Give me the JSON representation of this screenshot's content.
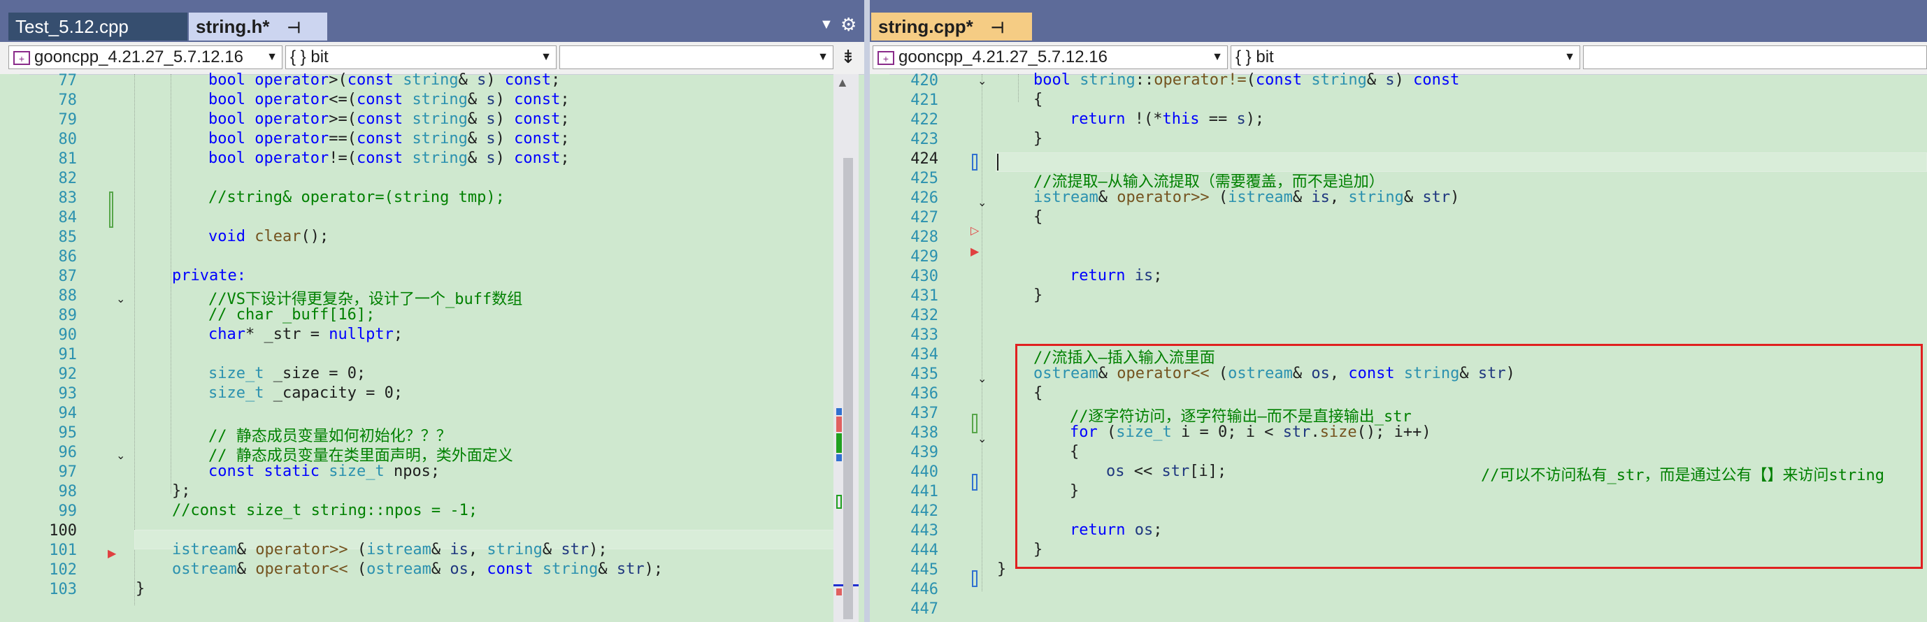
{
  "left_pane": {
    "tabs": [
      {
        "label": "Test_5.12.cpp",
        "state": "inactive"
      },
      {
        "label": "string.h*",
        "state": "active"
      }
    ],
    "nav": {
      "project": "gooncpp_4.21.27_5.7.12.16",
      "scope": "{ } bit",
      "member": ""
    },
    "current_line": "100",
    "lines": [
      {
        "n": "77"
      },
      {
        "n": "78"
      },
      {
        "n": "79"
      },
      {
        "n": "80"
      },
      {
        "n": "81"
      },
      {
        "n": "82"
      },
      {
        "n": "83"
      },
      {
        "n": "84"
      },
      {
        "n": "85"
      },
      {
        "n": "86"
      },
      {
        "n": "87"
      },
      {
        "n": "88"
      },
      {
        "n": "89"
      },
      {
        "n": "90"
      },
      {
        "n": "91"
      },
      {
        "n": "92"
      },
      {
        "n": "93"
      },
      {
        "n": "94"
      },
      {
        "n": "95"
      },
      {
        "n": "96"
      },
      {
        "n": "97"
      },
      {
        "n": "98"
      },
      {
        "n": "99"
      },
      {
        "n": "100"
      },
      {
        "n": "101"
      },
      {
        "n": "102"
      },
      {
        "n": "103"
      }
    ]
  },
  "right_pane": {
    "tabs": [
      {
        "label": "string.cpp*",
        "state": "active"
      }
    ],
    "nav": {
      "project": "gooncpp_4.21.27_5.7.12.16",
      "scope": "{ } bit",
      "member": ""
    },
    "current_line": "424",
    "lines": [
      {
        "n": "420"
      },
      {
        "n": "421"
      },
      {
        "n": "422"
      },
      {
        "n": "423"
      },
      {
        "n": "424"
      },
      {
        "n": "425"
      },
      {
        "n": "426"
      },
      {
        "n": "427"
      },
      {
        "n": "428"
      },
      {
        "n": "429"
      },
      {
        "n": "430"
      },
      {
        "n": "431"
      },
      {
        "n": "432"
      },
      {
        "n": "433"
      },
      {
        "n": "434"
      },
      {
        "n": "435"
      },
      {
        "n": "436"
      },
      {
        "n": "437"
      },
      {
        "n": "438"
      },
      {
        "n": "439"
      },
      {
        "n": "440"
      },
      {
        "n": "441"
      },
      {
        "n": "442"
      },
      {
        "n": "443"
      },
      {
        "n": "444"
      },
      {
        "n": "445"
      },
      {
        "n": "446"
      },
      {
        "n": "447"
      }
    ]
  },
  "code_text": {
    "l77": "bool operator>(const string& s) const;",
    "l78": "bool operator<=(const string& s) const;",
    "l79": "bool operator>=(const string& s) const;",
    "l80": "bool operator==(const string& s) const;",
    "l81": "bool operator!=(const string& s) const;",
    "l83": "//string& operator=(string tmp);",
    "l85": "void clear();",
    "l87": "private:",
    "l88": "//VS下设计得更复杂，设计了一个_buff数组",
    "l89": "// char _buff[16];",
    "l90": "char* _str = nullptr;",
    "l92": "size_t _size = 0;",
    "l93": "size_t _capacity = 0;",
    "l95": "// 静态成员变量如何初始化？？？",
    "l96": "// 静态成员变量在类里面声明，类外面定义",
    "l97": "const static size_t npos;",
    "l98": "};",
    "l99": "//const size_t string::npos = -1;",
    "l101": "istream& operator>> (istream& is, string& str);",
    "l102": "ostream& operator<< (ostream& os, const string& str);",
    "l103": "}",
    "r420": "bool string::operator!=(const string& s) const",
    "r421": "{",
    "r422": "return !(*this == s);",
    "r423": "}",
    "r425": "//流提取—从输入流提取（需要覆盖，而不是追加）",
    "r426": "istream& operator>> (istream& is, string& str)",
    "r427": "{",
    "r430": "return is;",
    "r431": "}",
    "r434": "//流插入—插入输入流里面",
    "r435": "ostream& operator<< (ostream& os, const string& str)",
    "r436": "{",
    "r437": "//逐字符访问，逐字符输出—而不是直接输出_str",
    "r438": "for (size_t i = 0; i < str.size(); i++)",
    "r439": "{",
    "r440": "os << str[i];",
    "r440c": "//可以不访问私有_str，而是通过公有【】来访问string",
    "r441": "}",
    "r443": "return os;",
    "r444": "}",
    "r445": "}"
  },
  "icons": {
    "pin": "pin-icon",
    "close": "close-icon",
    "dropdown": "chevron-down-icon",
    "settings": "gear-icon",
    "split": "split-editor-icon",
    "project": "cpp-project-icon"
  },
  "colors": {
    "editor_background": "#cfe8cf",
    "keyword": "#0000ff",
    "type": "#2b91af",
    "comment": "#008000",
    "function": "#74531f",
    "parameter": "#1f377f",
    "highlight_box": "#e02020",
    "tab_active_left": "#ccd5f0",
    "tab_active_right": "#f5cc84",
    "tabbar": "#5d6b99"
  }
}
